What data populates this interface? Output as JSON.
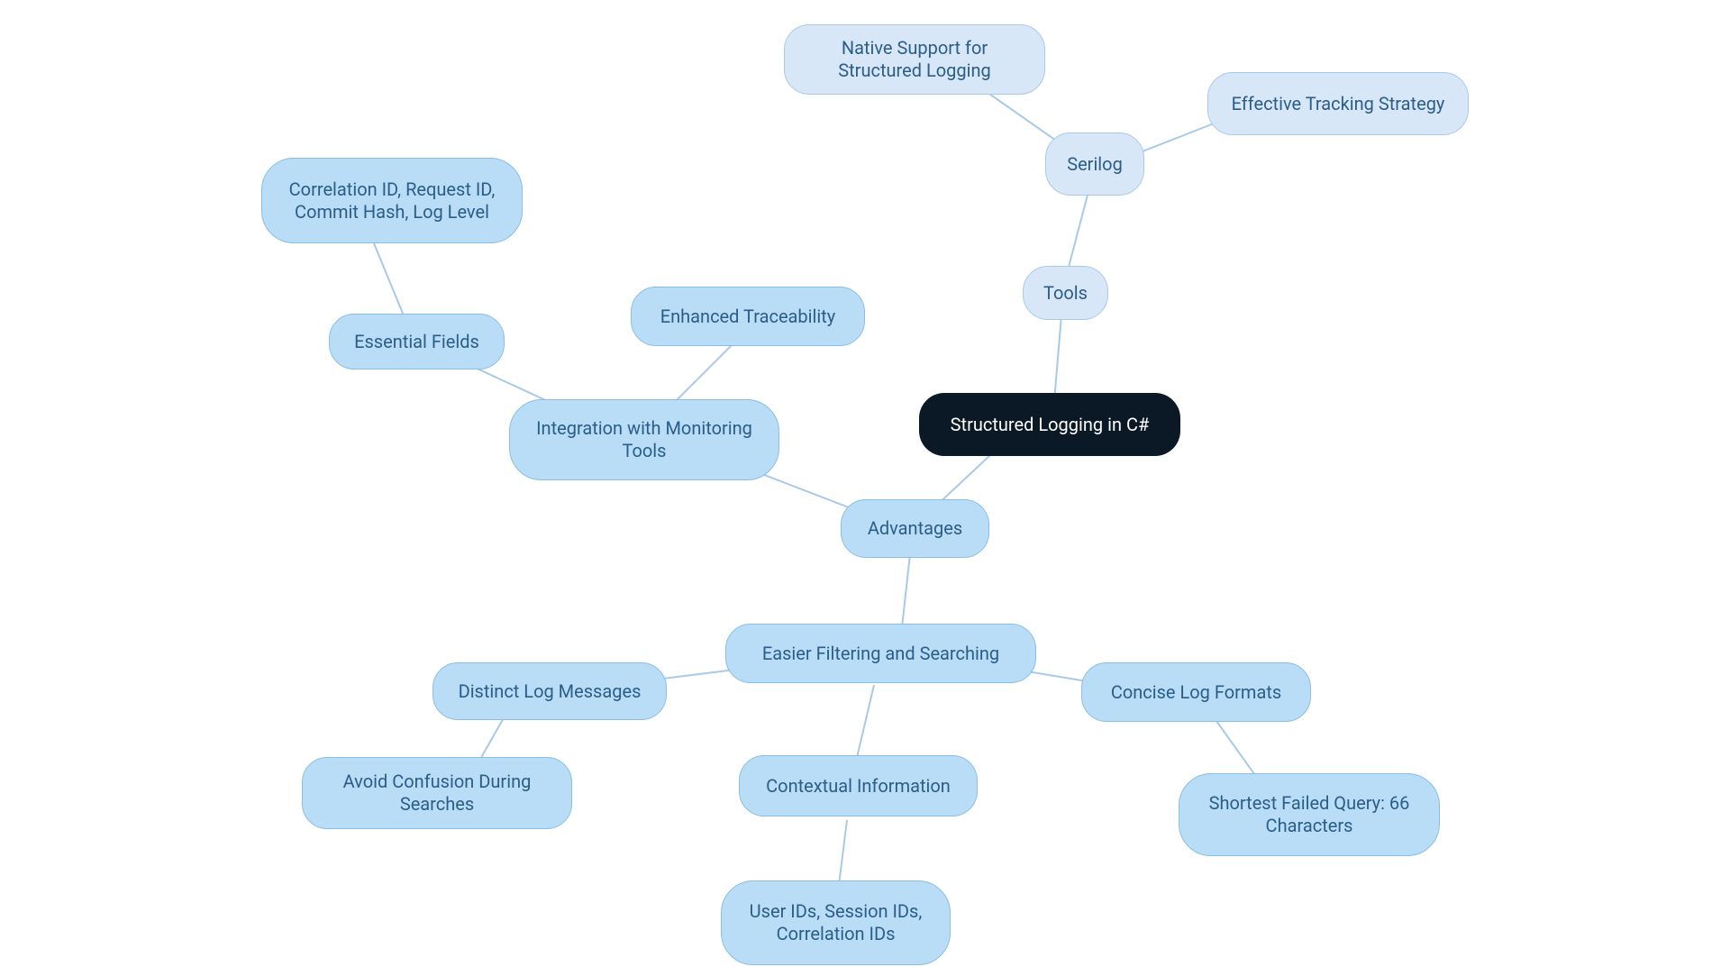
{
  "nodes": {
    "root": "Structured Logging in C#",
    "tools": "Tools",
    "serilog": "Serilog",
    "native_support": "Native Support for Structured Logging",
    "effective_tracking": "Effective Tracking Strategy",
    "advantages": "Advantages",
    "integration": "Integration with Monitoring Tools",
    "essential_fields": "Essential Fields",
    "correlation_fields": "Correlation ID, Request ID, Commit Hash, Log Level",
    "enhanced_traceability": "Enhanced Traceability",
    "easier_filtering": "Easier Filtering and Searching",
    "distinct_log": "Distinct Log Messages",
    "avoid_confusion": "Avoid Confusion During Searches",
    "contextual_info": "Contextual Information",
    "user_ids": "User IDs, Session IDs, Correlation IDs",
    "concise_formats": "Concise Log Formats",
    "shortest_failed": "Shortest Failed Query: 66 Characters"
  }
}
